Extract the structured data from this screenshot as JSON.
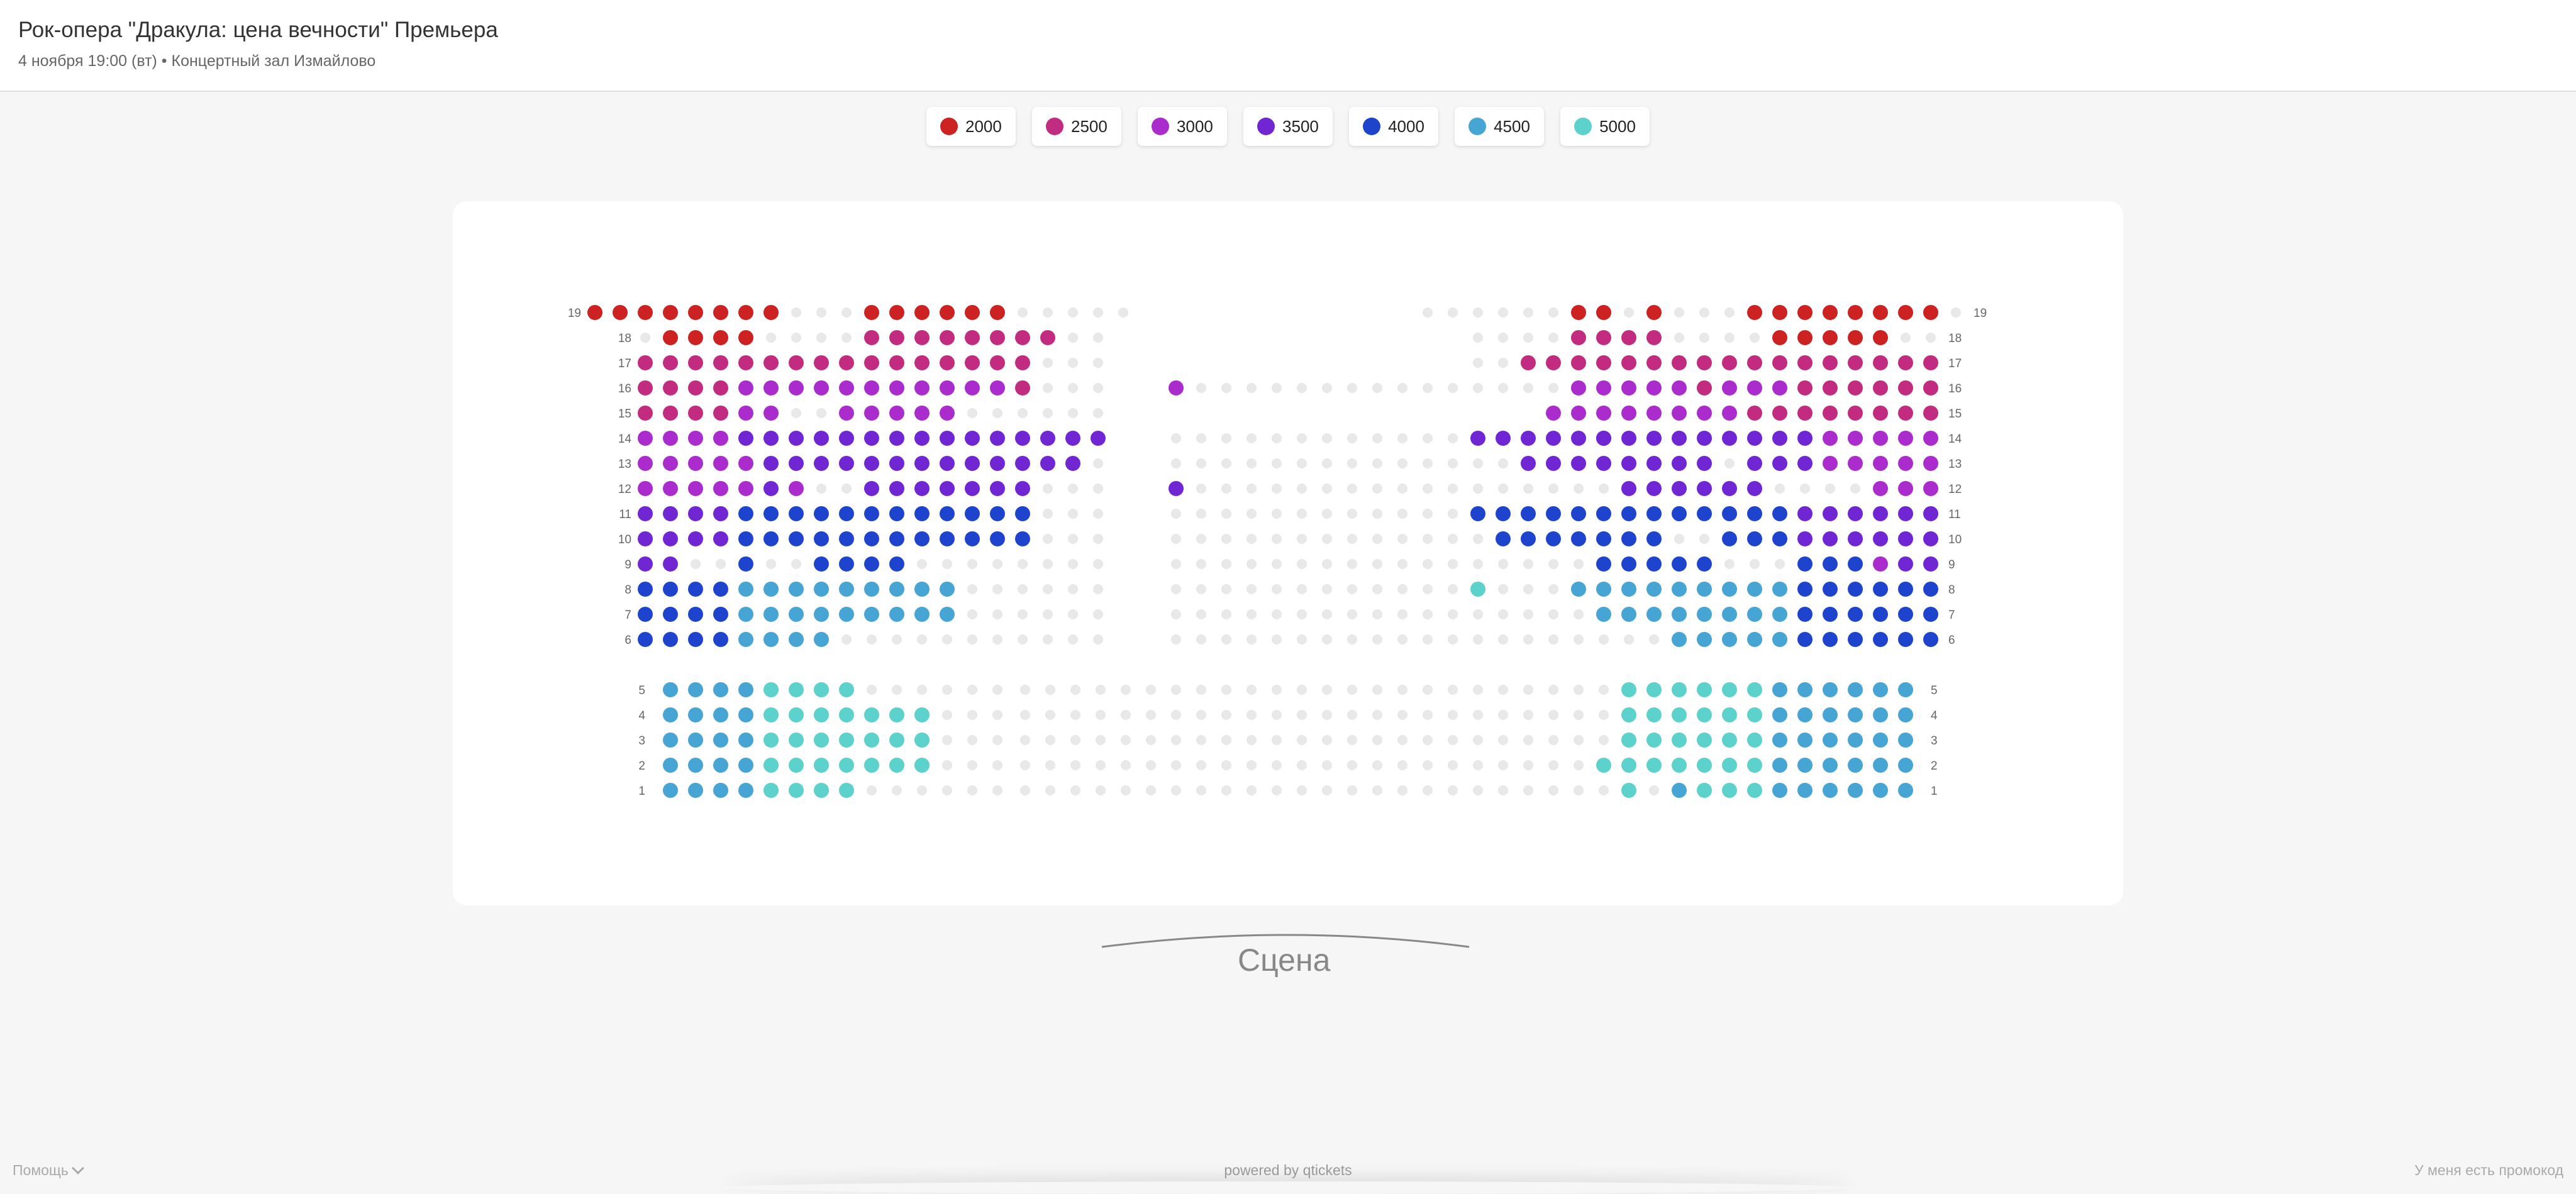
{
  "event": {
    "title": "Рок-опера \"Дракула: цена вечности\" Премьера",
    "subtitle": "4 ноября 19:00 (вт) • Концертный зал Измайлово"
  },
  "legend": [
    {
      "price": "2000",
      "color": "#cc2222"
    },
    {
      "price": "2500",
      "color": "#c22c80"
    },
    {
      "price": "3000",
      "color": "#aa2ccc"
    },
    {
      "price": "3500",
      "color": "#7126d3"
    },
    {
      "price": "4000",
      "color": "#1e44cd"
    },
    {
      "price": "4500",
      "color": "#46a5d2"
    },
    {
      "price": "5000",
      "color": "#5dd2cc"
    }
  ],
  "stage": {
    "label": "Сцена"
  },
  "footer": {
    "help": "Помощь",
    "powered": "powered by qtickets",
    "promo": "У меня есть промокод"
  },
  "seating": {
    "taken_color": "#e8e8e8",
    "price_codes": "0 = занято, 1 = 2000, 2 = 2500, 3 = 3000, 4 = 3500, 5 = 4000, 6 = 4500, 7 = 5000",
    "rows": [
      {
        "row": "19",
        "left": "1111111100011111100000",
        "center": "",
        "right": "0000001101000111111110"
      },
      {
        "row": "18",
        "left": "0111100002222222200",
        "center": "",
        "right": "0000222200001111100"
      },
      {
        "row": "17",
        "left": "2222222222222222000",
        "center": "",
        "right": "0022222222222222222"
      },
      {
        "row": "16",
        "left": "2222333333333332000",
        "center": "30000000000000000",
        "right": "00333332333222222"
      },
      {
        "row": "15",
        "left": "2222330033333000000",
        "center": "",
        "right": "3333333322222222"
      },
      {
        "row": "14",
        "left": "3333444444444444444",
        "center": "0000000000000000040",
        "right": "4444444444444433333"
      },
      {
        "row": "13",
        "left": "3333344444444444440",
        "center": "0000000000000000000",
        "right": "0044444444044433333"
      },
      {
        "row": "12",
        "left": "3333343004444444000",
        "center": "4000000000000000000",
        "right": "0000004444440000333"
      },
      {
        "row": "11",
        "left": "4444555555555555000",
        "center": "0000000000000000000",
        "right": "5555555555555444444"
      },
      {
        "row": "10",
        "left": "4444555555555555000",
        "center": "0000000000000000000",
        "right": "0555555500555444444"
      },
      {
        "row": "9",
        "left": "4400500555500000000",
        "center": "0000000000000000000",
        "right": "0000055555000555344"
      },
      {
        "row": "8",
        "left": "5555666666666000000",
        "center": "0000000000000000000",
        "right": "7000666666666555555"
      },
      {
        "row": "7",
        "left": "5555666666666000000",
        "center": "0000000000000000000",
        "right": "0000066666666555555"
      },
      {
        "row": "6",
        "left": "5555666600000000000",
        "center": "0000000000000000000",
        "right": "0000000066666555555"
      },
      {
        "row": "5",
        "left": "66667777000000",
        "center": "00000000000000000000000",
        "right": "0000777777666666"
      },
      {
        "row": "4",
        "left": "66667777777000",
        "center": "00000000000000000000000",
        "right": "0000777777666666"
      },
      {
        "row": "3",
        "left": "66667777777000",
        "center": "00000000000000000000000",
        "right": "0000777777666666"
      },
      {
        "row": "2",
        "left": "66667777777000",
        "center": "00000000000000000000000",
        "right": "0007777777666666"
      },
      {
        "row": "1",
        "left": "66667777000000",
        "center": "00000000000000000000000",
        "right": "0000706777666666"
      }
    ]
  }
}
